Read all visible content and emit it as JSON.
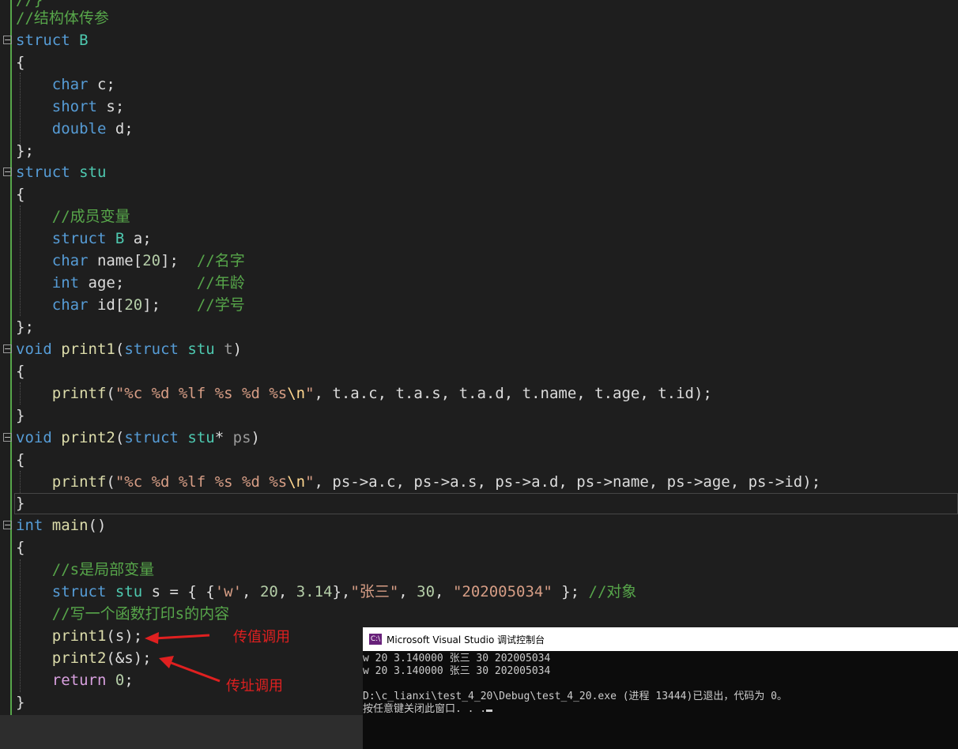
{
  "editor": {
    "lines": {
      "l0": "//}",
      "l1": "//结构体传参",
      "l2_kw": "struct",
      "l2_name": "B",
      "l3": "{",
      "l4_kw": "char",
      "l4_rest": "c;",
      "l5_kw": "short",
      "l5_rest": "s;",
      "l6_kw": "double",
      "l6_rest": "d;",
      "l7": "};",
      "l8_kw": "struct",
      "l8_name": "stu",
      "l9": "{",
      "l10": "//成员变量",
      "l11_kw": "struct",
      "l11_ty": "B",
      "l11_rest": "a;",
      "l12_kw": "char",
      "l12_a": "name[",
      "l12_n": "20",
      "l12_b": "];",
      "l12_cm": "//名字",
      "l13_kw": "int",
      "l13_a": "age;",
      "l13_cm": "//年龄",
      "l14_kw": "char",
      "l14_a": "id[",
      "l14_n": "20",
      "l14_b": "];",
      "l14_cm": "//学号",
      "l15": "};",
      "l16_kw": "void",
      "l16_fn": "print1",
      "l16_a": "(",
      "l16_kw2": "struct",
      "l16_ty": "stu",
      "l16_pm": "t",
      "l16_b": ")",
      "l17": "{",
      "l18_fn": "printf",
      "l18_a": "(",
      "l18_st": "\"%c %d %lf %s %d %s",
      "l18_esc": "\\n",
      "l18_st2": "\"",
      "l18_rest": ", t.a.c, t.a.s, t.a.d, t.name, t.age, t.id);",
      "l19": "}",
      "l20_kw": "void",
      "l20_fn": "print2",
      "l20_a": "(",
      "l20_kw2": "struct",
      "l20_ty": "stu",
      "l20_star": "*",
      "l20_pm": "ps",
      "l20_b": ")",
      "l21": "{",
      "l22_fn": "printf",
      "l22_a": "(",
      "l22_st": "\"%c %d %lf %s %d %s",
      "l22_esc": "\\n",
      "l22_st2": "\"",
      "l22_rest": ", ps->a.c, ps->a.s, ps->a.d, ps->name, ps->age, ps->id);",
      "l23": "}",
      "l24_kw": "int",
      "l24_fn": "main",
      "l24_rest": "()",
      "l25": "{",
      "l26": "//s是局部变量",
      "l27_kw": "struct",
      "l27_ty": "stu",
      "l27_a": "s = { {",
      "l27_s1": "'w'",
      "l27_b": ", ",
      "l27_n1": "20",
      "l27_c": ", ",
      "l27_n2": "3.14",
      "l27_d": "},",
      "l27_s2": "\"张三\"",
      "l27_e": ", ",
      "l27_n3": "30",
      "l27_f": ", ",
      "l27_s3": "\"202005034\"",
      "l27_g": " }; ",
      "l27_cm": "//对象",
      "l28": "//写一个函数打印s的内容",
      "l29_fn": "print1",
      "l29_rest": "(s);",
      "l30_fn": "print2",
      "l30_rest": "(&s);",
      "l31_kw": "return",
      "l31_n": "0",
      "l31_rest": ";",
      "l32": "}"
    }
  },
  "annotations": {
    "by_value": "传值调用",
    "by_address": "传址调用"
  },
  "console": {
    "title": "Microsoft Visual Studio 调试控制台",
    "icon": "vs-console-icon",
    "output": [
      "w 20 3.140000 张三 30 202005034",
      "w 20 3.140000 张三 30 202005034",
      "",
      "D:\\c_lianxi\\test_4_20\\Debug\\test_4_20.exe (进程 13444)已退出，代码为 0。",
      "按任意键关闭此窗口. . ."
    ]
  },
  "colors": {
    "keyword": "#569cd6",
    "type": "#4ec9b0",
    "comment": "#57a64a",
    "string": "#d69d85",
    "number": "#b5cea8",
    "function": "#dcdcaa",
    "annotation": "#e02020"
  }
}
